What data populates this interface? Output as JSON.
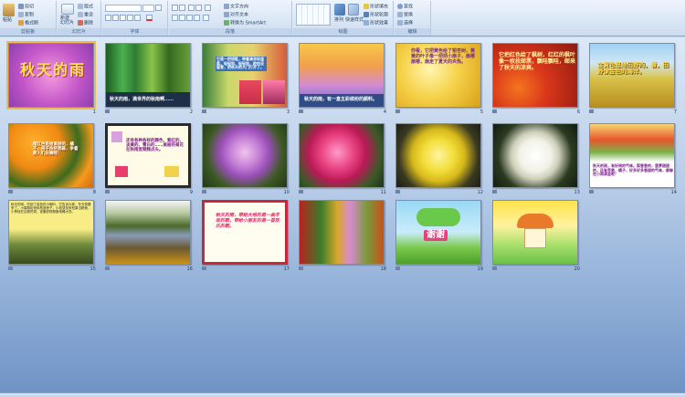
{
  "ribbon": {
    "groups": {
      "clipboard": "剪贴板",
      "slides": "幻灯片",
      "font": "字体",
      "paragraph": "段落",
      "drawing": "绘图",
      "editing": "编辑"
    },
    "buttons": {
      "paste": "粘贴",
      "cut": "剪切",
      "copy": "复制",
      "format_painter": "格式刷",
      "new_slide": "新建\n幻灯片",
      "layout": "版式",
      "reset": "重设",
      "delete": "删除",
      "text_direction": "文字方向",
      "align_text": "对齐文本",
      "convert_smartart": "转换为 SmartArt",
      "arrange": "排列",
      "quick_styles": "快速样式",
      "shape_fill": "形状填充",
      "shape_outline": "形状轮廓",
      "shape_effects": "形状效果",
      "find": "查找",
      "replace": "替换",
      "select": "选择"
    }
  },
  "slides": [
    {
      "number": "1",
      "text": "秋天的雨",
      "style": "title"
    },
    {
      "number": "2",
      "text": "秋天的雨，满世界的秋雨啊……"
    },
    {
      "number": "3",
      "text": "它是一把钥匙，带着清凉和温柔，轻轻地、轻轻地，趁你没留意，把秋天的大门打开了。"
    },
    {
      "number": "4",
      "text": "秋天的雨，有一盒五彩缤纷的颜料。"
    },
    {
      "number": "5",
      "text": "你看，它把黄色给了银杏树，黄黄的叶子像一把把小扇子，扇哪扇哪，扇走了夏天的炎热。"
    },
    {
      "number": "6",
      "text": "它把红色给了枫树，红红的枫叶像一枚枚邮票，飘哇飘哇，邮来了秋天的凉爽。"
    },
    {
      "number": "7",
      "text": "金黄色是给田野的，看，田野像金色的海洋。"
    },
    {
      "number": "8",
      "text": "橙红色是给果树的，橘子、柿子你挤我碰，争着要人们去摘呢！"
    },
    {
      "number": "9",
      "text": "还有各种各样的颜色，紫红的、淡黄的、雪白的……美丽的菊花在秋雨里频频点头。"
    },
    {
      "number": "10",
      "text": ""
    },
    {
      "number": "11",
      "text": ""
    },
    {
      "number": "12",
      "text": ""
    },
    {
      "number": "13",
      "text": ""
    },
    {
      "number": "14",
      "text": "秋天的雨，有好闻的气味。梨香香的，菠萝甜甜的，还有苹果、橘子，好多好多香甜的气味，都躲在小雨滴里呢！"
    },
    {
      "number": "15",
      "text": "秋天的雨，吹起了金色的小喇叭，它告诉大家，冬天快要来了。小喜鹊衔来树枝造房子，小松鼠找来松果当粮食，小青蛙在加紧挖洞，准备舒舒服服地睡大觉。"
    },
    {
      "number": "16",
      "text": ""
    },
    {
      "number": "17",
      "text": "秋天的雨，带给大地的是一曲丰收的歌，带给小朋友的是一首欢乐的歌。"
    },
    {
      "number": "18",
      "text": ""
    },
    {
      "number": "19",
      "text": "谢谢"
    },
    {
      "number": "20",
      "text": ""
    }
  ],
  "colors": {
    "selection": "#f2b84c",
    "ribbon_bg": "#dbe7f6",
    "workspace_top": "#dce8f6",
    "workspace_bottom": "#6f93c6"
  }
}
